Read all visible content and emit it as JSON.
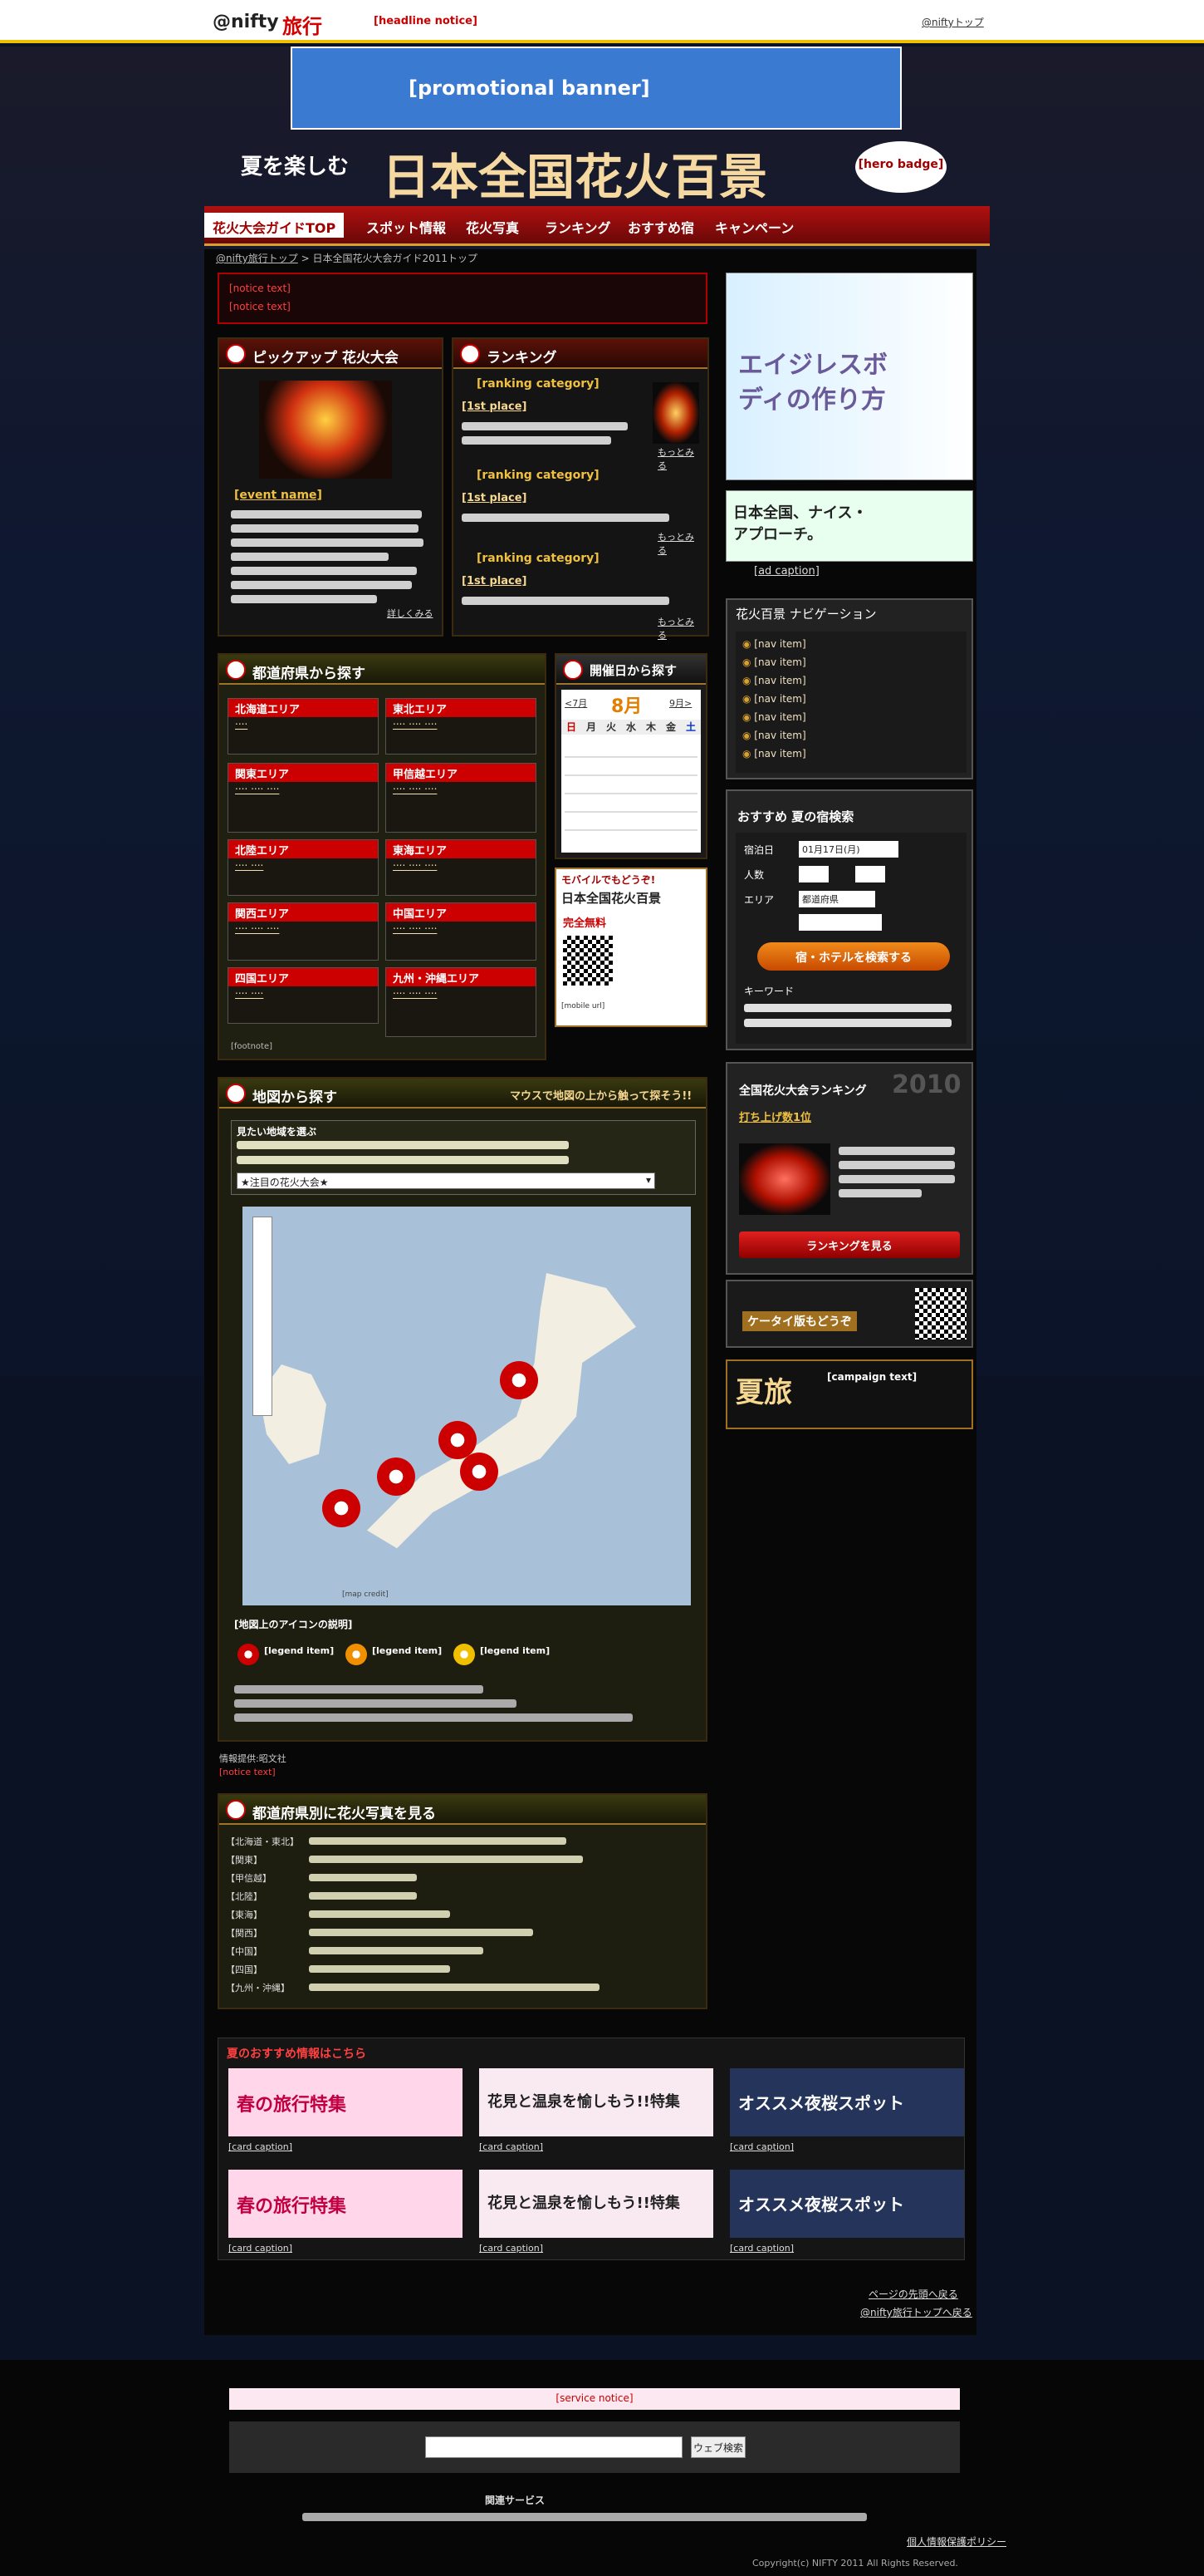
{
  "topbar": {
    "brand": "@nifty",
    "brand2": "旅行",
    "notice": "[headline notice]",
    "right_link": "@niftyトップ"
  },
  "promo_banner": {
    "text": "[promotional banner]"
  },
  "hero": {
    "title": "日本全国花火百景",
    "subtitle": "夏を楽しむ",
    "badge": "[hero badge]"
  },
  "nav": {
    "items": [
      "花火大会ガイドTOP",
      "スポット情報",
      "花火写真",
      "ランキング",
      "おすすめ宿",
      "キャンペーン"
    ]
  },
  "breadcrumb": {
    "home": "@nifty旅行トップ",
    "current": "日本全国花火大会ガイド2011トップ"
  },
  "alert": {
    "line1": "[notice text]",
    "line2": "[notice text]"
  },
  "pickup": {
    "title": "ピックアップ 花火大会",
    "event_link": "[event name]",
    "more": "詳しくみる"
  },
  "ranking": {
    "title": "ランキング",
    "sections": [
      {
        "heading": "[ranking category]",
        "first": "[1st place]",
        "more": "もっとみる"
      },
      {
        "heading": "[ranking category]",
        "first": "[1st place]",
        "more": "もっとみる"
      },
      {
        "heading": "[ranking category]",
        "first": "[1st place]",
        "more": "もっとみる"
      }
    ]
  },
  "prefectures": {
    "title": "都道府県から探す",
    "areas": [
      "北海道エリア",
      "東北エリア",
      "関東エリア",
      "甲信越エリア",
      "北陸エリア",
      "東海エリア",
      "関西エリア",
      "中国エリア",
      "四国エリア",
      "九州・沖縄エリア"
    ],
    "note": "[footnote]"
  },
  "calendar": {
    "title": "開催日から探す",
    "month": "8月",
    "prev": "<7月",
    "next": "9月>",
    "weekdays": [
      "日",
      "月",
      "火",
      "水",
      "木",
      "金",
      "土"
    ]
  },
  "mobile": {
    "title": "モバイルでもどうぞ!",
    "brand": "日本全国花火百景",
    "free": "完全無料",
    "url": "[mobile url]"
  },
  "map": {
    "title": "地図から探す",
    "hint": "マウスで地図の上から触って探そう!!",
    "area_head": "見たい地域を選ぶ",
    "select_value": "★注目の花火大会★",
    "legend_title": "[地図上のアイコンの説明]",
    "legend": [
      "[legend item]",
      "[legend item]",
      "[legend item]"
    ],
    "credit": "[map credit]"
  },
  "info": {
    "provider": "情報提供:昭文社",
    "warning": "[notice text]"
  },
  "photos": {
    "title": "都道府県別に花火写真を見る",
    "rows": [
      "【北海道・東北】",
      "【関東】",
      "【甲信越】",
      "【北陸】",
      "【東海】",
      "【関西】",
      "【中国】",
      "【四国】",
      "【九州・沖縄】"
    ]
  },
  "recommend": {
    "title": "夏のおすすめ情報はこちら",
    "cards": [
      "春の旅行特集",
      "花見と温泉を愉しもう!!特集",
      "オススメ夜桜スポット",
      "春の旅行特集",
      "花見と温泉を愉しもう!!特集",
      "オススメ夜桜スポット"
    ],
    "caption": "[card caption]"
  },
  "sidebar": {
    "ad1": "エイジレスボディの作り方",
    "ad2": "日本全国、ナイス・アプローチ。",
    "ad2_link": "[ad caption]",
    "nav_title": "花火百景 ナビゲーション",
    "nav_items": [
      "[nav item]",
      "[nav item]",
      "[nav item]",
      "[nav item]",
      "[nav item]",
      "[nav item]",
      "[nav item]"
    ],
    "hotel_title": "おすすめ 夏の宿検索",
    "date_label": "宿泊日",
    "date_value": "01月17日(月)",
    "people_label": "人数",
    "area_label": "エリア",
    "area_value": "都道府県",
    "search_btn": "宿・ホテルを検索する",
    "keyword_label": "キーワード",
    "rank_title": "全国花火大会ランキング",
    "rank_year": "2010",
    "rank_first": "打ち上げ数1位",
    "rank_btn": "ランキングを見る",
    "mobile_title": "ケータイ版もどうぞ",
    "camp_title": "夏旅",
    "camp_text": "[campaign text]"
  },
  "pagelinks": {
    "top": "ページの先頭へ戻る",
    "home": "@nifty旅行トップへ戻る"
  },
  "footer": {
    "notice": "[service notice]",
    "search_btn": "ウェブ検索",
    "related": "関連サービス",
    "privacy": "個人情報保護ポリシー",
    "copyright": "Copyright(c) NIFTY 2011 All Rights Reserved."
  },
  "colors": {
    "accent": "#cc0000",
    "gold": "#d8a030",
    "bg": "#0a1224"
  }
}
